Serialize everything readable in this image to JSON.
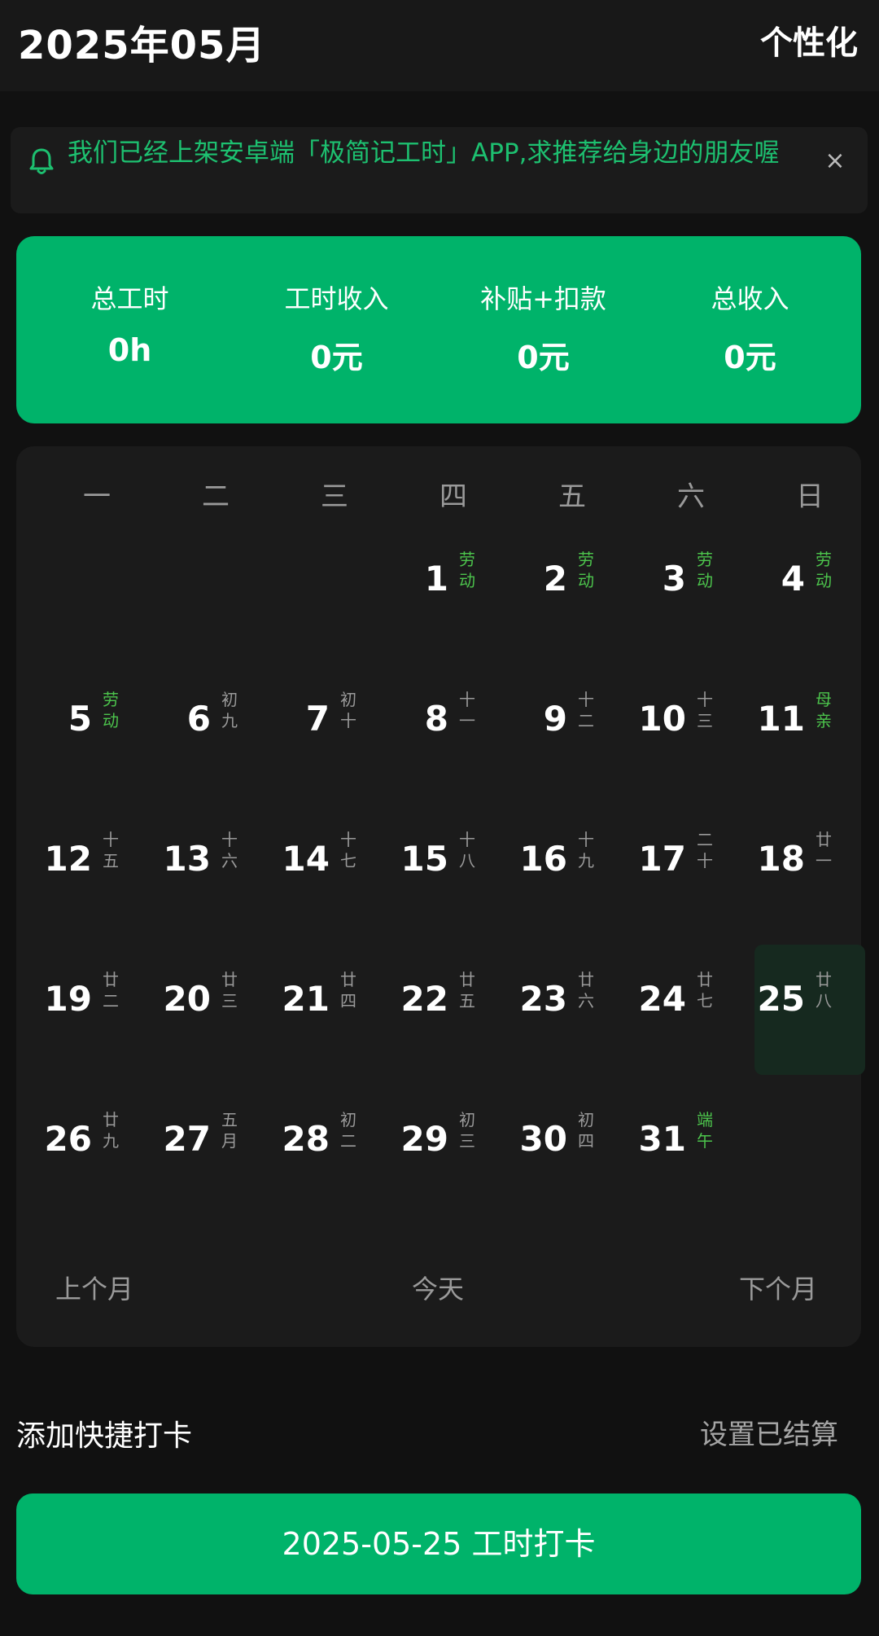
{
  "header": {
    "title": "2025年05月",
    "action": "个性化"
  },
  "notice": {
    "text": "我们已经上架安卓端「极简记工时」APP,求推荐给身边的朋友喔",
    "close": "×"
  },
  "summary": [
    {
      "label": "总工时",
      "value": "0h"
    },
    {
      "label": "工时收入",
      "value": "0元"
    },
    {
      "label": "补贴+扣款",
      "value": "0元"
    },
    {
      "label": "总收入",
      "value": "0元"
    }
  ],
  "calendar": {
    "weekdays": [
      "一",
      "二",
      "三",
      "四",
      "五",
      "六",
      "日"
    ],
    "first_weekday_index": 3,
    "today": 25,
    "days": [
      {
        "num": "1",
        "lunar": [
          "劳",
          "动"
        ],
        "holiday": true
      },
      {
        "num": "2",
        "lunar": [
          "劳",
          "动"
        ],
        "holiday": true
      },
      {
        "num": "3",
        "lunar": [
          "劳",
          "动"
        ],
        "holiday": true
      },
      {
        "num": "4",
        "lunar": [
          "劳",
          "动"
        ],
        "holiday": true
      },
      {
        "num": "5",
        "lunar": [
          "劳",
          "动"
        ],
        "holiday": true
      },
      {
        "num": "6",
        "lunar": [
          "初",
          "九"
        ],
        "holiday": false
      },
      {
        "num": "7",
        "lunar": [
          "初",
          "十"
        ],
        "holiday": false
      },
      {
        "num": "8",
        "lunar": [
          "十",
          "一"
        ],
        "holiday": false
      },
      {
        "num": "9",
        "lunar": [
          "十",
          "二"
        ],
        "holiday": false
      },
      {
        "num": "10",
        "lunar": [
          "十",
          "三"
        ],
        "holiday": false
      },
      {
        "num": "11",
        "lunar": [
          "母",
          "亲"
        ],
        "holiday": true
      },
      {
        "num": "12",
        "lunar": [
          "十",
          "五"
        ],
        "holiday": false
      },
      {
        "num": "13",
        "lunar": [
          "十",
          "六"
        ],
        "holiday": false
      },
      {
        "num": "14",
        "lunar": [
          "十",
          "七"
        ],
        "holiday": false
      },
      {
        "num": "15",
        "lunar": [
          "十",
          "八"
        ],
        "holiday": false
      },
      {
        "num": "16",
        "lunar": [
          "十",
          "九"
        ],
        "holiday": false
      },
      {
        "num": "17",
        "lunar": [
          "二",
          "十"
        ],
        "holiday": false
      },
      {
        "num": "18",
        "lunar": [
          "廿",
          "一"
        ],
        "holiday": false
      },
      {
        "num": "19",
        "lunar": [
          "廿",
          "二"
        ],
        "holiday": false
      },
      {
        "num": "20",
        "lunar": [
          "廿",
          "三"
        ],
        "holiday": false
      },
      {
        "num": "21",
        "lunar": [
          "廿",
          "四"
        ],
        "holiday": false
      },
      {
        "num": "22",
        "lunar": [
          "廿",
          "五"
        ],
        "holiday": false
      },
      {
        "num": "23",
        "lunar": [
          "廿",
          "六"
        ],
        "holiday": false
      },
      {
        "num": "24",
        "lunar": [
          "廿",
          "七"
        ],
        "holiday": false
      },
      {
        "num": "25",
        "lunar": [
          "廿",
          "八"
        ],
        "holiday": false
      },
      {
        "num": "26",
        "lunar": [
          "廿",
          "九"
        ],
        "holiday": false
      },
      {
        "num": "27",
        "lunar": [
          "五",
          "月"
        ],
        "holiday": false
      },
      {
        "num": "28",
        "lunar": [
          "初",
          "二"
        ],
        "holiday": false
      },
      {
        "num": "29",
        "lunar": [
          "初",
          "三"
        ],
        "holiday": false
      },
      {
        "num": "30",
        "lunar": [
          "初",
          "四"
        ],
        "holiday": false
      },
      {
        "num": "31",
        "lunar": [
          "端",
          "午"
        ],
        "holiday": true
      }
    ],
    "nav": {
      "prev": "上个月",
      "today": "今天",
      "next": "下个月"
    }
  },
  "actions": {
    "quick_punch": "添加快捷打卡",
    "settled": "设置已结算",
    "punch_button": "2025-05-25 工时打卡"
  },
  "colors": {
    "accent": "#00b36a",
    "holiday": "#4cc44c",
    "notice_text": "#1dc070"
  }
}
